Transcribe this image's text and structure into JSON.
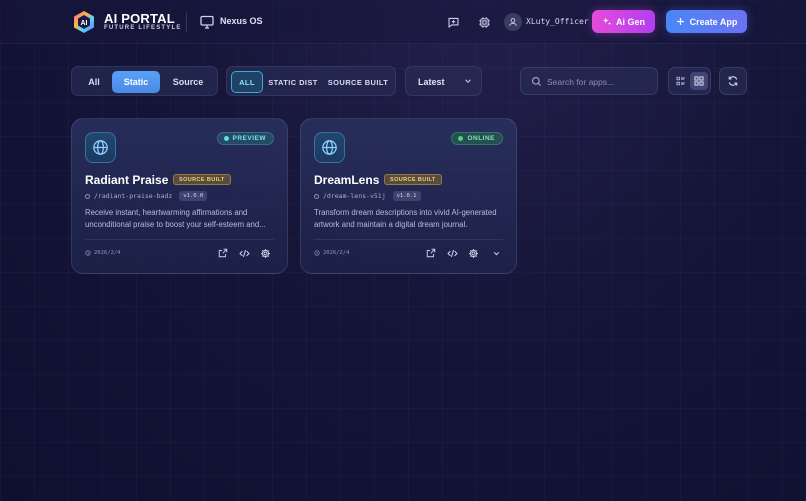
{
  "header": {
    "brand_title": "AI PORTAL",
    "brand_subtitle": "FUTURE LIFESTYLE",
    "os_label": "Nexus OS",
    "username": "XLuty_Officer",
    "ai_gen_label": "Ai Gen",
    "create_app_label": "Create App",
    "colors": {
      "ai_gen": "#d946ef",
      "create_app": "#5b7ff5"
    }
  },
  "filters": {
    "type_tabs": [
      {
        "label": "All",
        "active": false
      },
      {
        "label": "Static",
        "active": true
      },
      {
        "label": "Source",
        "active": false
      }
    ],
    "build_tabs": [
      {
        "label": "ALL",
        "active": true
      },
      {
        "label": "STATIC DIST",
        "active": false
      },
      {
        "label": "SOURCE BUILT",
        "active": false
      }
    ],
    "sort": {
      "selected": "Latest"
    },
    "search": {
      "placeholder": "Search for apps...",
      "value": ""
    },
    "view_mode": "grid"
  },
  "apps": [
    {
      "title": "Radiant Praise",
      "status": "PREVIEW",
      "build_badge": "SOURCE BUILT",
      "slug": "/radiant-praise-badz",
      "version": "v1.0.0",
      "description": "Receive instant, heartwarming affirmations and unconditional praise to boost your self-esteem and...",
      "date": "2026/2/4",
      "icon": "globe-icon"
    },
    {
      "title": "DreamLens",
      "status": "ONLINE",
      "build_badge": "SOURCE BUILT",
      "slug": "/dream-lens-v51j",
      "version": "v1.0.1",
      "description": "Transform dream descriptions into vivid AI-generated artwork and maintain a digital dream journal.",
      "date": "2026/2/4",
      "icon": "globe-icon"
    }
  ]
}
